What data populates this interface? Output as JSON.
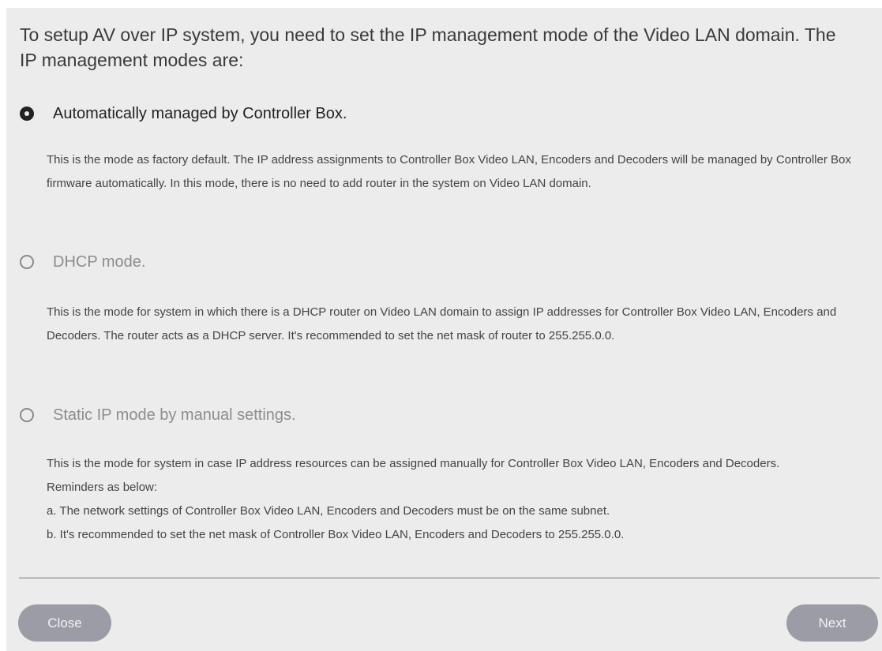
{
  "intro": "To setup AV over IP system, you need to set the IP management mode of the Video LAN domain. The IP management modes are:",
  "options": [
    {
      "label": "Automatically managed by Controller Box.",
      "selected": true,
      "description": [
        "This is the mode as factory default. The IP address assignments to Controller Box Video LAN, Encoders and Decoders will be managed by Controller Box firmware automatically. In this mode, there is no need to add router in the system on Video LAN domain."
      ]
    },
    {
      "label": "DHCP mode.",
      "selected": false,
      "description": [
        "This is the mode for system in which there is a DHCP router on Video LAN domain to assign IP addresses for Controller Box Video LAN, Encoders and Decoders. The router acts as a DHCP server. It's recommended to set the net mask of router to 255.255.0.0."
      ]
    },
    {
      "label": "Static IP mode by manual settings.",
      "selected": false,
      "description": [
        "This is the mode for system in case IP address resources can be assigned manually for Controller Box Video LAN, Encoders and Decoders. Reminders as below:",
        "a. The network settings of Controller Box Video LAN, Encoders and Decoders must be on the same subnet.",
        "b. It's recommended to set the net mask of Controller Box Video LAN, Encoders and Decoders to 255.255.0.0."
      ]
    }
  ],
  "buttons": {
    "close": "Close",
    "next": "Next"
  }
}
